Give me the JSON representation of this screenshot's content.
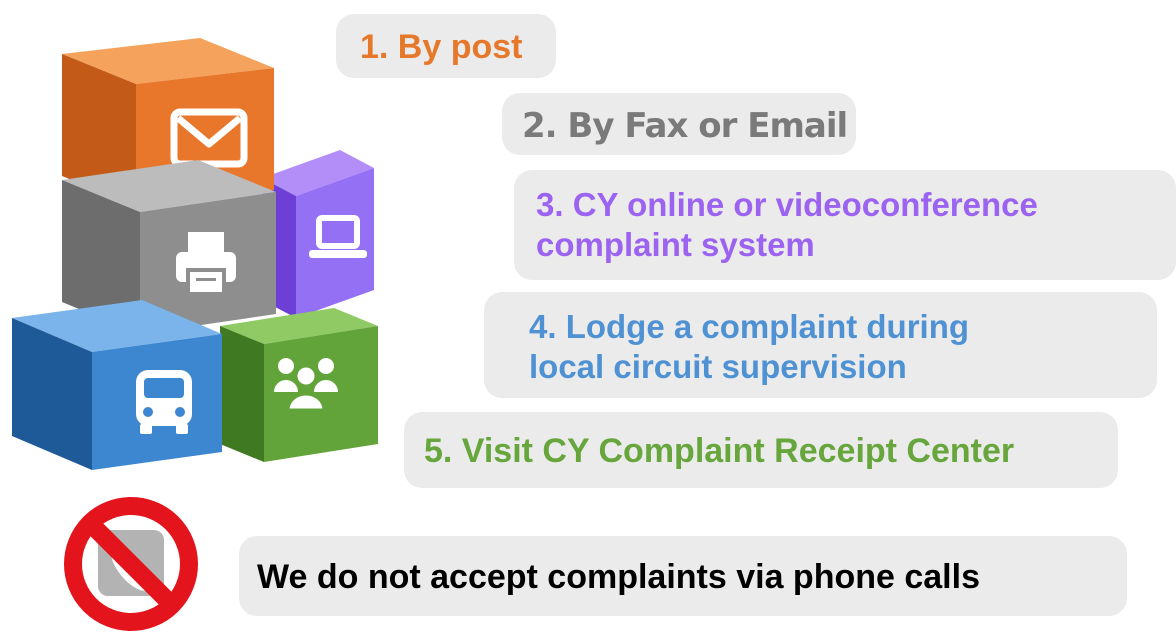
{
  "methods": [
    {
      "label": "1. By post",
      "icon": "envelope-icon",
      "color": "#e6782b"
    },
    {
      "label": "2. By Fax or Email",
      "icon": "printer-icon",
      "color": "#7a7a7a"
    },
    {
      "label_line1": "3. CY online or videoconference",
      "label_line2": "complaint system",
      "icon": "laptop-icon",
      "color": "#9b63f0"
    },
    {
      "label_line1": "4. Lodge a complaint during",
      "label_line2": "local circuit supervision",
      "icon": "bus-icon",
      "color": "#4f92d4"
    },
    {
      "label": "5. Visit CY Complaint Receipt Center",
      "icon": "people-icon",
      "color": "#67a63c"
    }
  ],
  "notice": {
    "label": "We do not accept complaints via phone calls",
    "icon": "no-phone-icon"
  }
}
